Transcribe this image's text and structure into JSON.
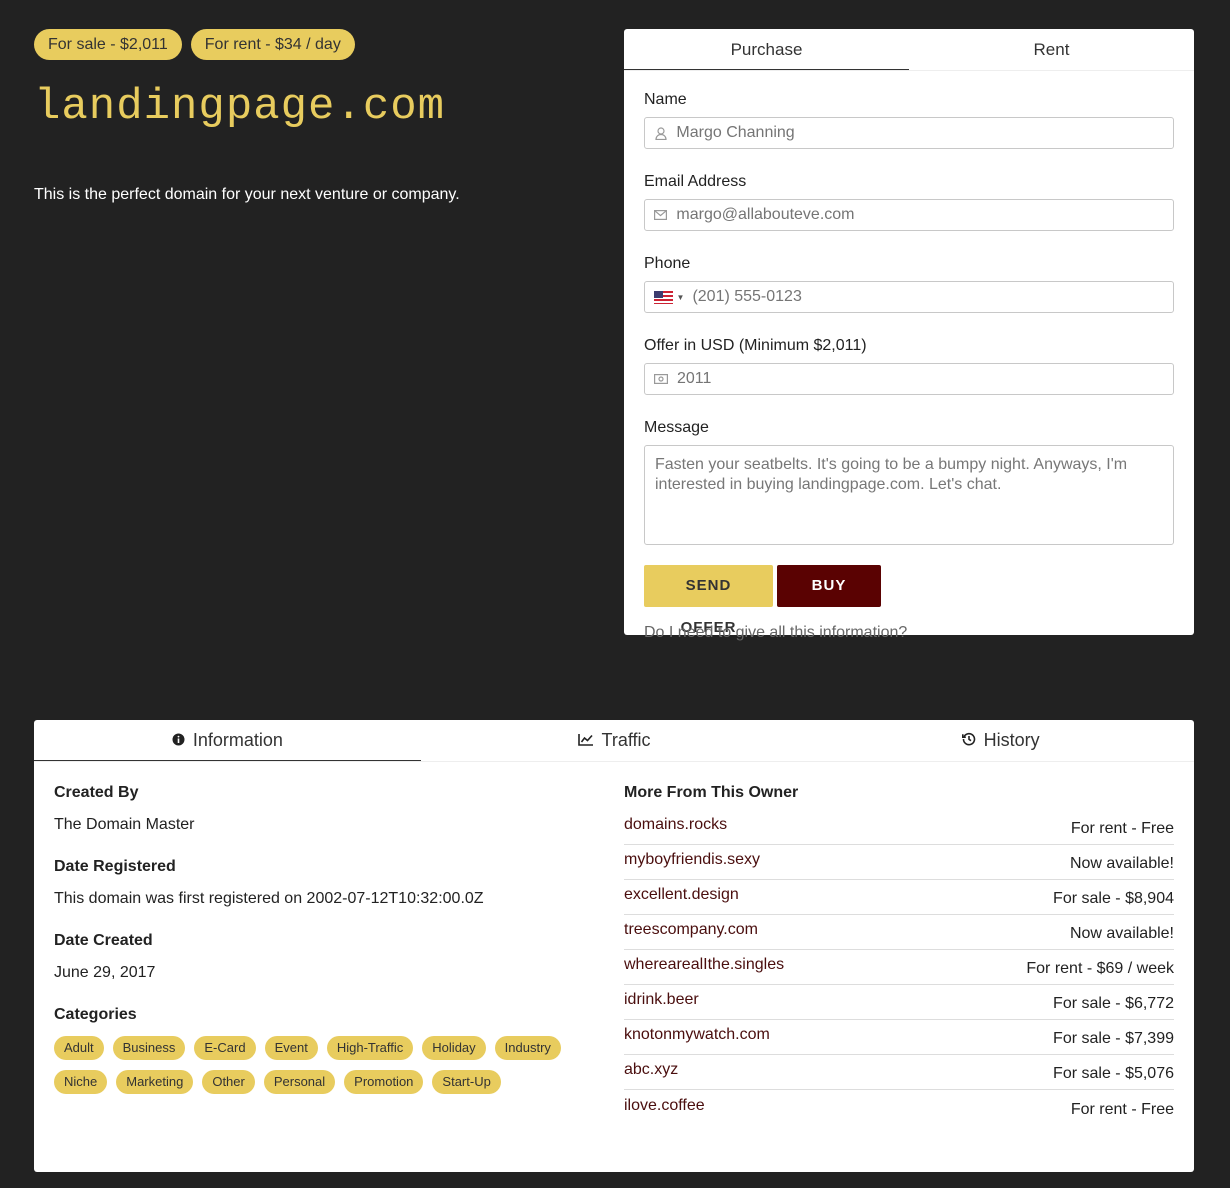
{
  "badges": {
    "sale": "For sale - $2,011",
    "rent": "For rent - $34 / day"
  },
  "domain": "landingpage.com",
  "tagline": "This is the perfect domain for your next venture or company.",
  "offer_form": {
    "tabs": [
      "Purchase",
      "Rent"
    ],
    "name_label": "Name",
    "name_placeholder": "Margo Channing",
    "email_label": "Email Address",
    "email_placeholder": "margo@allabouteve.com",
    "phone_label": "Phone",
    "phone_placeholder": "(201) 555-0123",
    "offer_label": "Offer in USD (Minimum $2,011)",
    "offer_placeholder": "2011",
    "message_label": "Message",
    "message_placeholder": "Fasten your seatbelts. It's going to be a bumpy night. Anyways, I'm interested in buying landingpage.com. Let's chat.",
    "send_label": "SEND OFFER",
    "buy_label": "BUY NOW",
    "info_link": "Do I need to give all this information?"
  },
  "info": {
    "tabs": [
      "Information",
      "Traffic",
      "History"
    ],
    "created_by_label": "Created By",
    "created_by": "The Domain Master",
    "registered_label": "Date Registered",
    "registered": "This domain was first registered on 2002-07-12T10:32:00.0Z",
    "created_label": "Date Created",
    "created": "June 29, 2017",
    "categories_label": "Categories",
    "categories": [
      "Adult",
      "Business",
      "E-Card",
      "Event",
      "High-Traffic",
      "Holiday",
      "Industry",
      "Niche",
      "Marketing",
      "Other",
      "Personal",
      "Promotion",
      "Start-Up"
    ],
    "owner_label": "More From This Owner",
    "owner_domains": [
      {
        "name": "domains.rocks",
        "status": "For rent - Free"
      },
      {
        "name": "myboyfriendis.sexy",
        "status": "Now available!"
      },
      {
        "name": "excellent.design",
        "status": "For sale - $8,904"
      },
      {
        "name": "treescompany.com",
        "status": "Now available!"
      },
      {
        "name": "wherearealIthe.singles",
        "status": "For rent - $69 / week"
      },
      {
        "name": "idrink.beer",
        "status": "For sale - $6,772"
      },
      {
        "name": "knotonmywatch.com",
        "status": "For sale - $7,399"
      },
      {
        "name": "abc.xyz",
        "status": "For sale - $5,076"
      },
      {
        "name": "ilove.coffee",
        "status": "For rent - Free"
      }
    ]
  },
  "colors": {
    "background": "#222222",
    "accent": "#e8cc5e",
    "buy_button": "#5a0202",
    "link": "#4a0e0e"
  }
}
